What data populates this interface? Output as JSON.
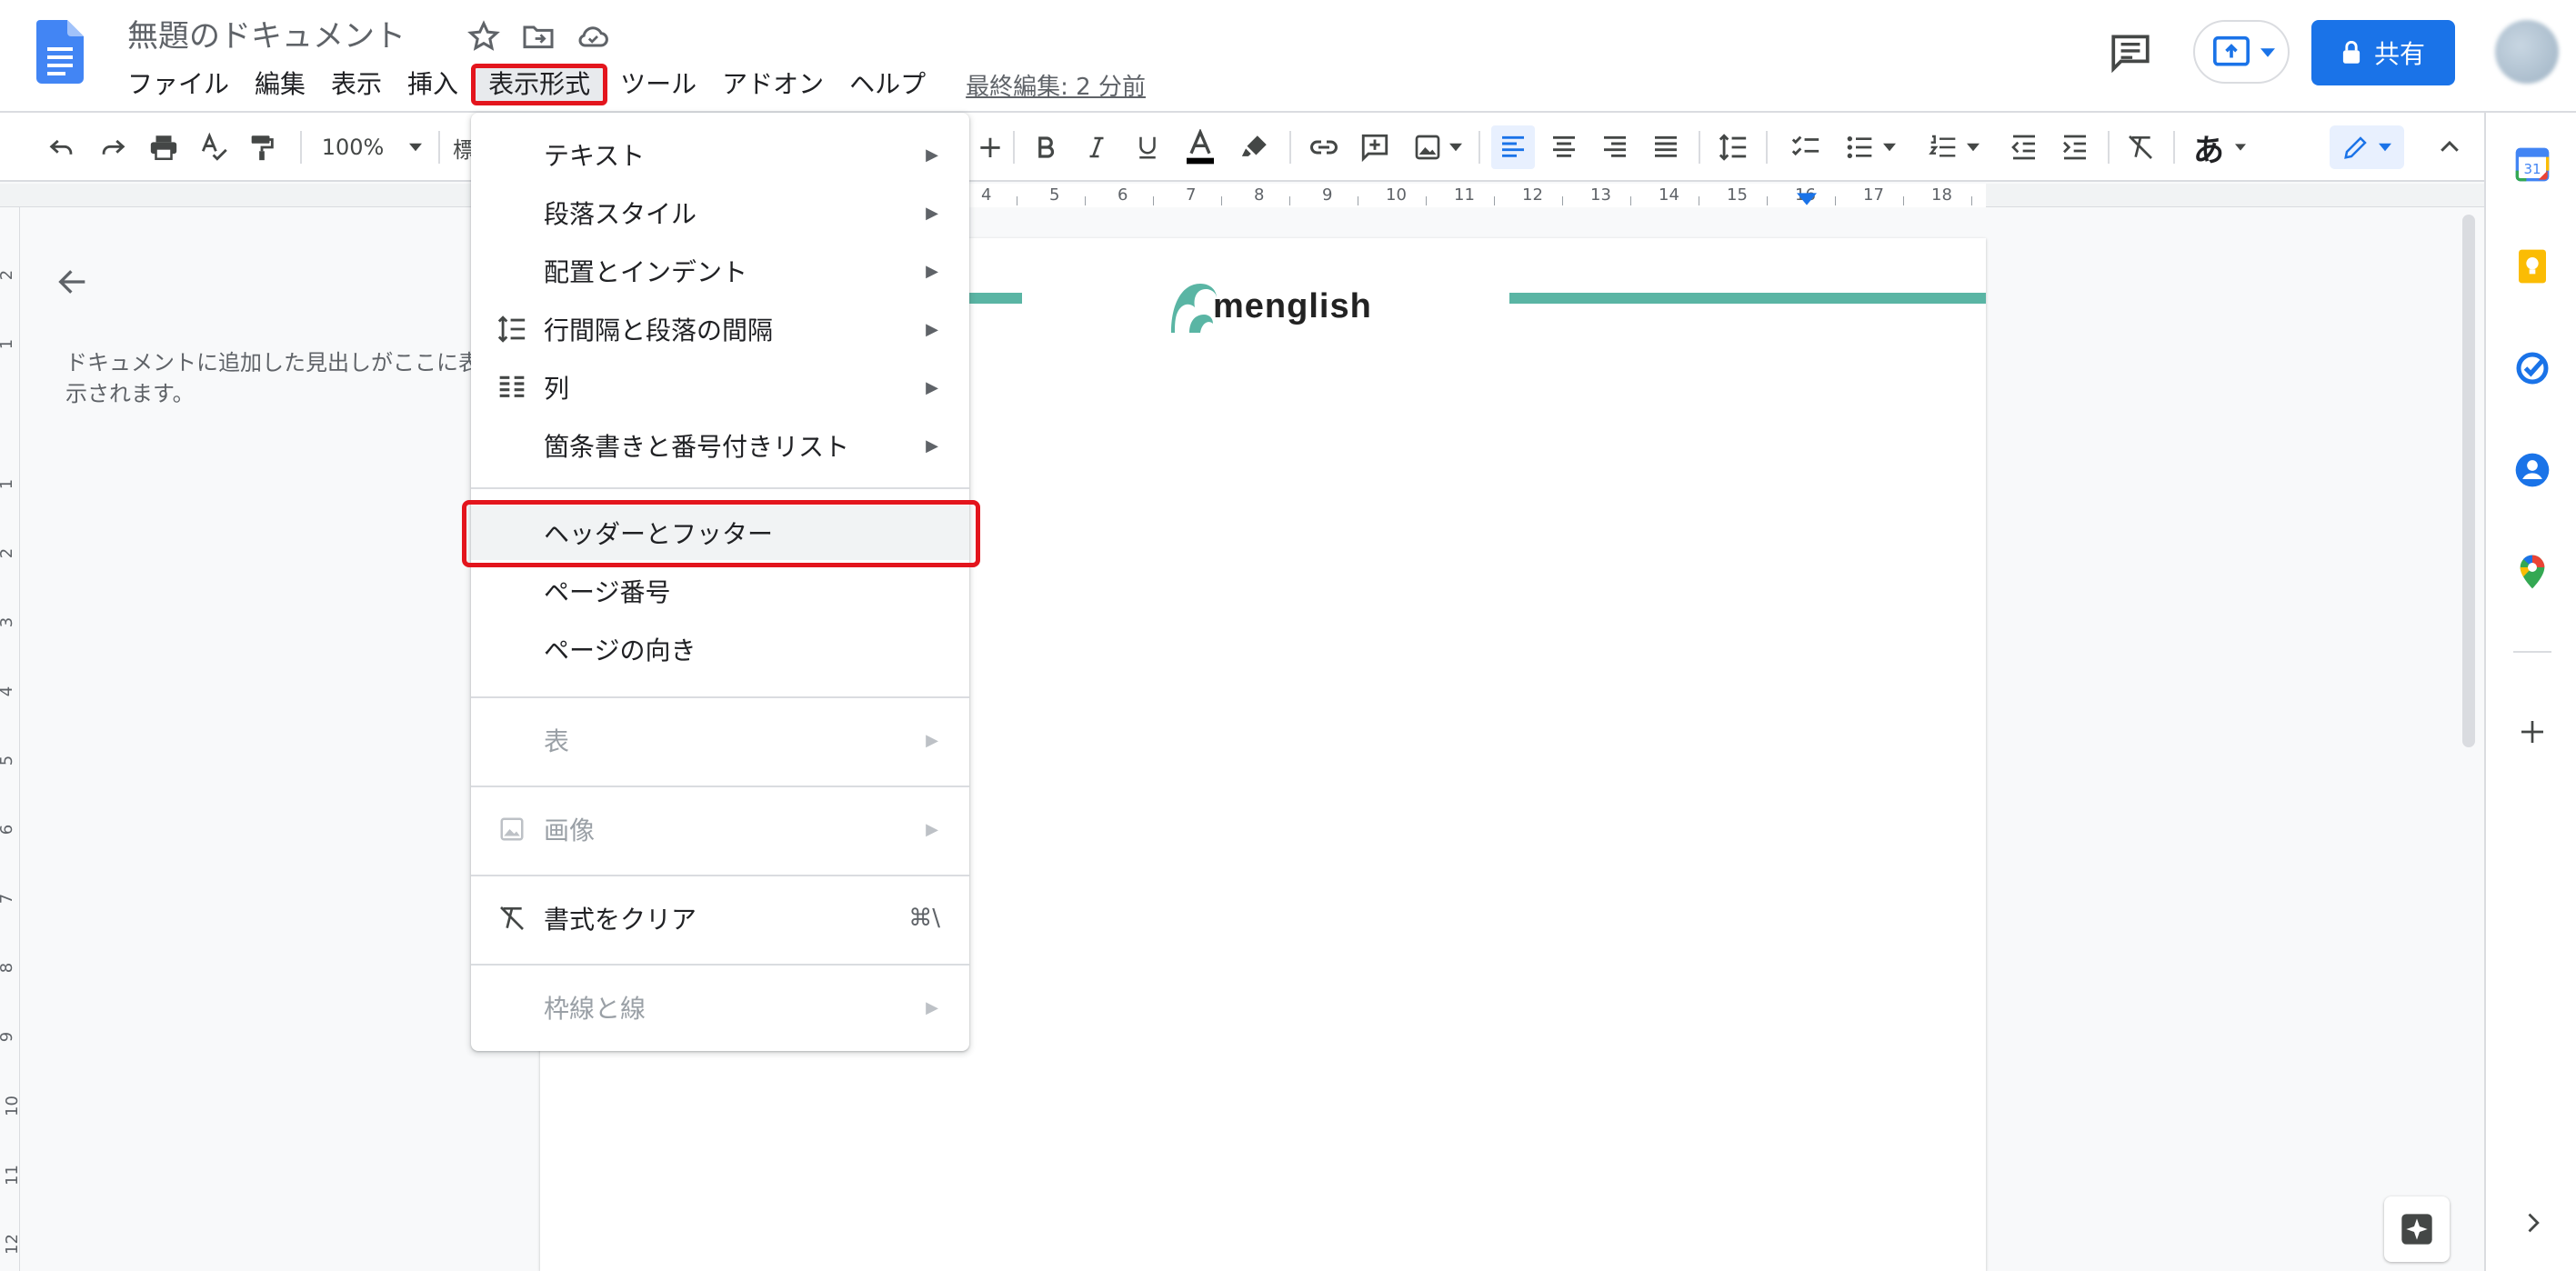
{
  "app": {
    "doc_title": "無題のドキュメント",
    "last_edit": "最終編集: 2 分前",
    "share_label": "共有",
    "accent_color": "#1a73e8"
  },
  "menubar": {
    "items": [
      "ファイル",
      "編集",
      "表示",
      "挿入",
      "表示形式",
      "ツール",
      "アドオン",
      "ヘルプ"
    ],
    "active": "表示形式"
  },
  "toolbar": {
    "zoom": "100%",
    "style_truncated": "標",
    "font_size_plus": "+",
    "input_tools": "あ",
    "icons": [
      "undo-icon",
      "redo-icon",
      "print-icon",
      "spellcheck-icon",
      "paint-format-icon",
      "bold-icon",
      "italic-icon",
      "underline-icon",
      "text-color-icon",
      "highlight-icon",
      "link-icon",
      "add-comment-icon",
      "insert-image-icon",
      "align-left-icon",
      "align-center-icon",
      "align-right-icon",
      "justify-icon",
      "line-spacing-icon",
      "checklist-icon",
      "bulleted-list-icon",
      "numbered-list-icon",
      "decrease-indent-icon",
      "increase-indent-icon",
      "clear-formatting-icon",
      "editing-mode-icon",
      "collapse-icon"
    ]
  },
  "ruler": {
    "numbers": [
      "4",
      "5",
      "6",
      "7",
      "8",
      "9",
      "10",
      "11",
      "12",
      "13",
      "14",
      "15",
      "16",
      "17",
      "18"
    ]
  },
  "vertical_ruler": {
    "numbers": [
      "2",
      "1",
      "1",
      "2",
      "3",
      "4",
      "5",
      "6",
      "7",
      "8",
      "9",
      "10",
      "11",
      "12"
    ]
  },
  "outline": {
    "hint": "ドキュメントに追加した見出しがここに表示されます。"
  },
  "page": {
    "logo_text": "menglish",
    "brand_color": "#5ab5a4"
  },
  "format_menu": {
    "items": [
      {
        "label": "テキスト",
        "submenu": true
      },
      {
        "label": "段落スタイル",
        "submenu": true
      },
      {
        "label": "配置とインデント",
        "submenu": true
      },
      {
        "label": "行間隔と段落の間隔",
        "submenu": true,
        "icon": "line-spacing-icon"
      },
      {
        "label": "列",
        "submenu": true,
        "icon": "columns-icon"
      },
      {
        "label": "箇条書きと番号付きリスト",
        "submenu": true
      },
      {
        "label": "ヘッダーとフッター",
        "highlighted": true
      },
      {
        "label": "ページ番号"
      },
      {
        "label": "ページの向き"
      },
      {
        "label": "表",
        "submenu": true,
        "disabled": true
      },
      {
        "label": "画像",
        "submenu": true,
        "disabled": true,
        "icon": "image-icon"
      },
      {
        "label": "書式をクリア",
        "shortcut": "⌘\\",
        "icon": "clear-formatting-icon"
      },
      {
        "label": "枠線と線",
        "submenu": true,
        "disabled": true
      }
    ]
  },
  "side_panel": {
    "icons": [
      "calendar-icon",
      "keep-icon",
      "tasks-icon",
      "contacts-icon",
      "maps-icon",
      "add-addon-icon",
      "expand-panel-icon"
    ],
    "calendar_day": "31"
  },
  "highlight_color": "#e3151d"
}
